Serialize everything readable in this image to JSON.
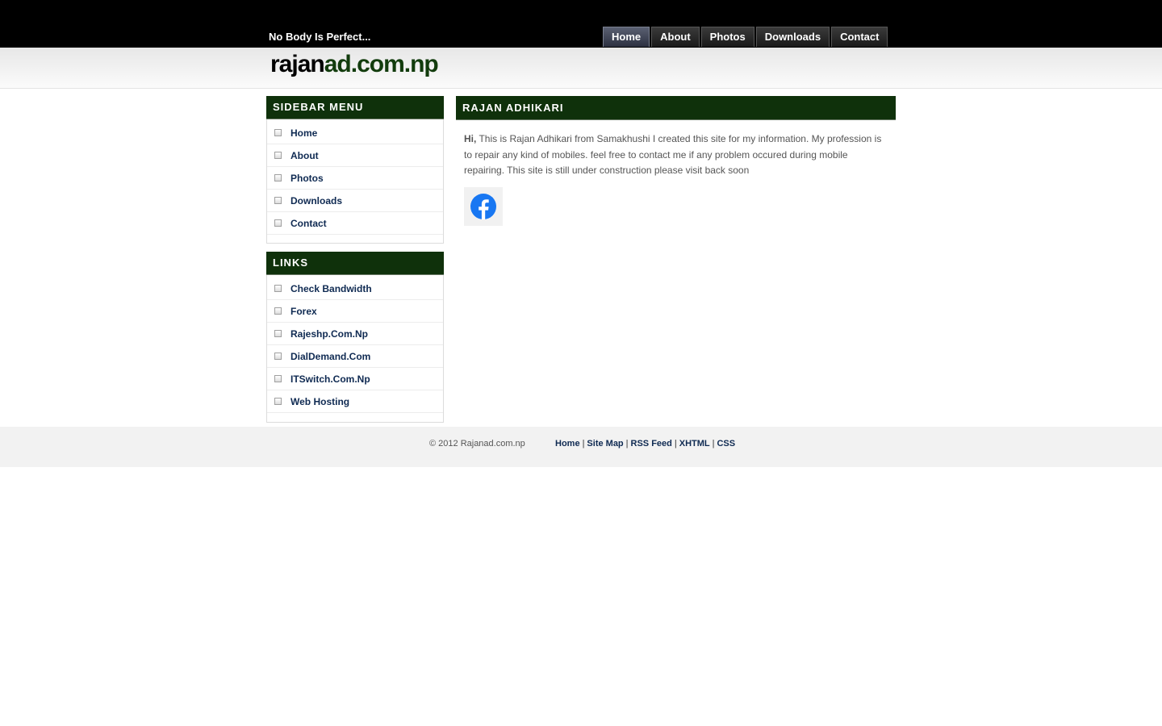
{
  "header": {
    "tagline": "No Body Is Perfect...",
    "logo_part1": "rajan",
    "logo_part2": "ad.com.np"
  },
  "nav": {
    "tabs": [
      {
        "label": "Home",
        "active": true
      },
      {
        "label": "About"
      },
      {
        "label": "Photos"
      },
      {
        "label": "Downloads"
      },
      {
        "label": "Contact"
      }
    ]
  },
  "sidebar_menu": {
    "title": "SIDEBAR MENU",
    "items": [
      "Home",
      "About",
      "Photos",
      "Downloads",
      "Contact"
    ]
  },
  "links": {
    "title": "LINKS",
    "items": [
      "Check Bandwidth",
      "Forex",
      "Rajeshp.Com.Np",
      "DialDemand.Com",
      "ITSwitch.Com.Np",
      "Web Hosting"
    ]
  },
  "main": {
    "title": "RAJAN ADHIKARI",
    "greeting": "Hi,",
    "body": " This is Rajan Adhikari from Samakhushi I created this site for my information. My profession is to repair any kind of mobiles. feel free to contact me if any problem occured during mobile repairing. This site is still under construction please visit back soon",
    "social_icon": "facebook-icon",
    "facebook_color": "#1877f2"
  },
  "footer": {
    "copyright": "© 2012 Rajanad.com.np",
    "links": [
      "Home",
      "Site Map",
      "RSS Feed",
      "XHTML",
      "CSS"
    ],
    "separator": "|"
  },
  "colors": {
    "heading_bg": "#0f310b",
    "link": "#0f2a52",
    "logo_green": "#123c0d"
  }
}
